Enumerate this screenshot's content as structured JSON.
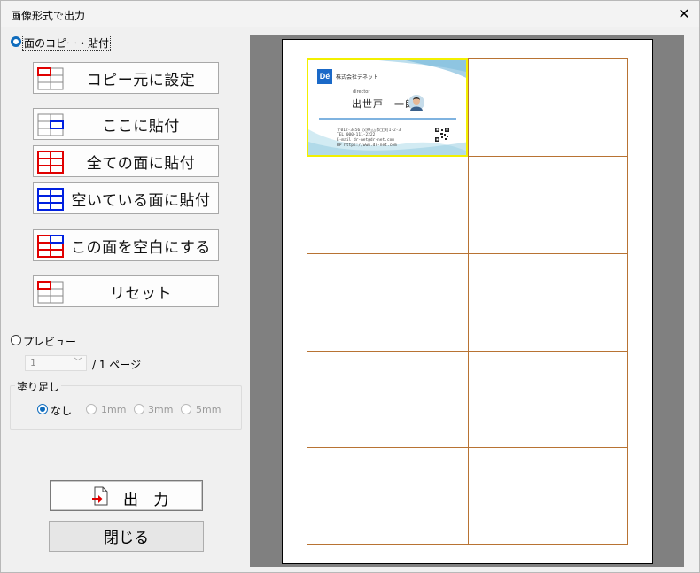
{
  "window": {
    "title": "画像形式で出力",
    "close_glyph": "✕"
  },
  "mode_face_copy": {
    "label": "面のコピー・貼付"
  },
  "buttons": {
    "set_copy_source": "コピー元に設定",
    "paste_here": "ここに貼付",
    "paste_all": "全ての面に貼付",
    "paste_empty": "空いている面に貼付",
    "clear_face": "この面を空白にする",
    "reset": "リセット"
  },
  "mode_preview": {
    "label": "プレビュー"
  },
  "page_select": {
    "value": "1",
    "suffix": "/ 1 ページ"
  },
  "bleed": {
    "title": "塗り足し",
    "options": [
      "なし",
      "1mm",
      "3mm",
      "5mm"
    ],
    "selected": "なし"
  },
  "output_button": "出 力",
  "close_button": "閉じる",
  "business_card": {
    "logo": "Dé",
    "company": "株式会社デネット",
    "role": "director",
    "name": "出世戸　一郎",
    "address": "〒012-3456 ○○県△△市□□町1-2-3",
    "tel": "TEL 000-111-2222",
    "email": "E-mail dr-net@dr-net.com",
    "hp": "HP https://www.dr-net.com"
  },
  "colors": {
    "accent_blue": "#0f6cbd",
    "grid_orange": "#b87333",
    "selected_yellow": "#f2f000",
    "icon_red": "#e00000",
    "icon_blue": "#0020e0"
  }
}
